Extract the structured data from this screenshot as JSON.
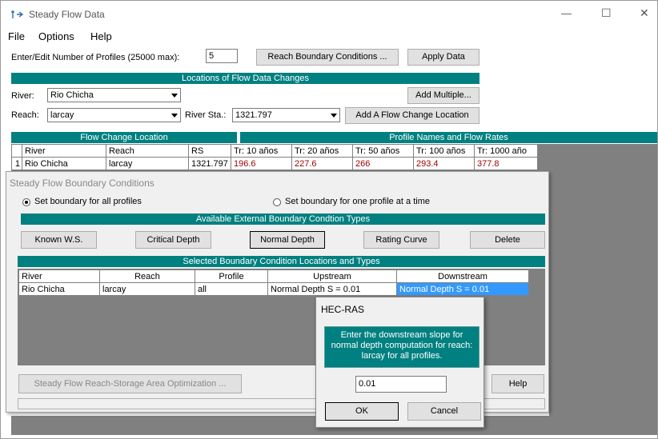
{
  "window": {
    "title": "Steady Flow Data",
    "minimize": "—",
    "maximize": "☐",
    "close": "✕"
  },
  "menu": [
    "File",
    "Options",
    "Help"
  ],
  "profiles": {
    "label": "Enter/Edit Number of Profiles (25000 max):",
    "value": "5"
  },
  "buttons": {
    "reach_boundary": "Reach Boundary Conditions ...",
    "apply_data": "Apply Data",
    "add_multiple": "Add Multiple...",
    "add_flow_change": "Add A Flow Change Location"
  },
  "locations_header": "Locations of Flow Data Changes",
  "river": {
    "label": "River:",
    "value": "Rio Chicha"
  },
  "reach": {
    "label": "Reach:",
    "value": "larcay"
  },
  "river_sta": {
    "label": "River Sta.:",
    "value": "1321.797"
  },
  "flow_table": {
    "header_left": "Flow Change Location",
    "header_right": "Profile Names and Flow Rates",
    "columns": [
      "River",
      "Reach",
      "RS",
      "Tr: 10 años",
      "Tr: 20 años",
      "Tr: 50 años",
      "Tr: 100 años",
      "Tr: 1000 año"
    ],
    "row": {
      "num": "1",
      "river": "Rio Chicha",
      "reach": "larcay",
      "rs": "1321.797",
      "flows": [
        "196.6",
        "227.6",
        "266",
        "293.4",
        "377.8"
      ]
    }
  },
  "bc_dialog": {
    "title": "Steady Flow Boundary Conditions",
    "radio_all": "Set boundary for all profiles",
    "radio_one": "Set boundary for one profile at a time",
    "types_header": "Available External Boundary Condtion Types",
    "type_buttons": [
      "Known W.S.",
      "Critical Depth",
      "Normal Depth",
      "Rating Curve",
      "Delete"
    ],
    "selected_header": "Selected Boundary Condition Locations and Types",
    "columns": [
      "River",
      "Reach",
      "Profile",
      "Upstream",
      "Downstream"
    ],
    "row": {
      "river": "Rio Chicha",
      "reach": "larcay",
      "profile": "all",
      "upstream": "Normal Depth S = 0.01",
      "downstream": "Normal Depth S = 0.01"
    },
    "optimization_button": "Steady Flow Reach-Storage Area Optimization ...",
    "help_button": "Help"
  },
  "hecras": {
    "title": "HEC-RAS",
    "message": "Enter the downstream slope for normal depth computation for reach: larcay   for all profiles.",
    "input_value": "0.01",
    "ok": "OK",
    "cancel": "Cancel"
  }
}
